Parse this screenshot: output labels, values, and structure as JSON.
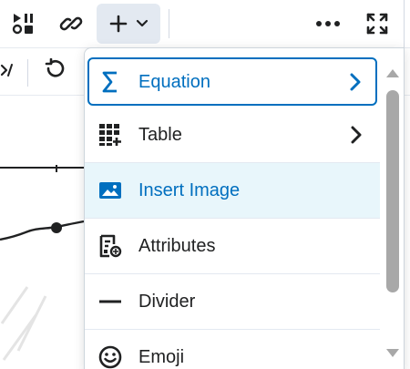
{
  "toolbar": {
    "icons": [
      "arrange-icon",
      "link-icon",
      "plus-icon",
      "chevron-down-icon",
      "more-icon",
      "fullscreen-icon"
    ],
    "second_row_icons": [
      "source-code-icon",
      "undo-icon"
    ]
  },
  "menu": {
    "items": [
      {
        "label": "Equation",
        "icon": "sigma-icon",
        "has_submenu": true,
        "state": "focused"
      },
      {
        "label": "Table",
        "icon": "table-icon",
        "has_submenu": true,
        "state": "normal"
      },
      {
        "label": "Insert Image",
        "icon": "image-icon",
        "has_submenu": false,
        "state": "hover"
      },
      {
        "label": "Attributes",
        "icon": "attributes-icon",
        "has_submenu": false,
        "state": "normal"
      },
      {
        "label": "Divider",
        "icon": "divider-icon",
        "has_submenu": false,
        "state": "normal"
      },
      {
        "label": "Emoji",
        "icon": "emoji-icon",
        "has_submenu": false,
        "state": "normal"
      }
    ]
  },
  "colors": {
    "accent": "#006fbf",
    "icon_dark": "#202122",
    "hover_bg": "#e8f6fb",
    "insert_button_bg": "#e3e9f1",
    "scroll_thumb": "#a8a8a8"
  }
}
